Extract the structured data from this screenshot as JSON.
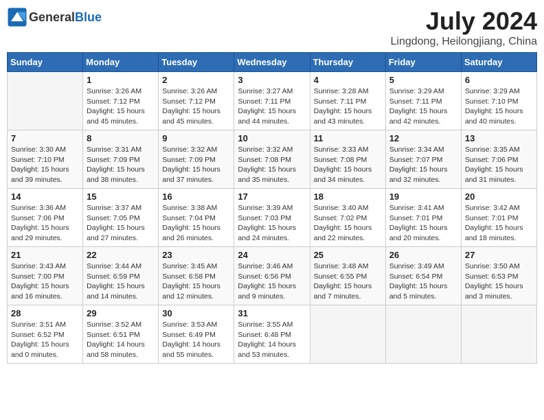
{
  "header": {
    "logo_general": "General",
    "logo_blue": "Blue",
    "month_title": "July 2024",
    "location": "Lingdong, Heilongjiang, China"
  },
  "weekdays": [
    "Sunday",
    "Monday",
    "Tuesday",
    "Wednesday",
    "Thursday",
    "Friday",
    "Saturday"
  ],
  "weeks": [
    [
      {
        "day": "",
        "info": ""
      },
      {
        "day": "1",
        "info": "Sunrise: 3:26 AM\nSunset: 7:12 PM\nDaylight: 15 hours\nand 45 minutes."
      },
      {
        "day": "2",
        "info": "Sunrise: 3:26 AM\nSunset: 7:12 PM\nDaylight: 15 hours\nand 45 minutes."
      },
      {
        "day": "3",
        "info": "Sunrise: 3:27 AM\nSunset: 7:11 PM\nDaylight: 15 hours\nand 44 minutes."
      },
      {
        "day": "4",
        "info": "Sunrise: 3:28 AM\nSunset: 7:11 PM\nDaylight: 15 hours\nand 43 minutes."
      },
      {
        "day": "5",
        "info": "Sunrise: 3:29 AM\nSunset: 7:11 PM\nDaylight: 15 hours\nand 42 minutes."
      },
      {
        "day": "6",
        "info": "Sunrise: 3:29 AM\nSunset: 7:10 PM\nDaylight: 15 hours\nand 40 minutes."
      }
    ],
    [
      {
        "day": "7",
        "info": "Sunrise: 3:30 AM\nSunset: 7:10 PM\nDaylight: 15 hours\nand 39 minutes."
      },
      {
        "day": "8",
        "info": "Sunrise: 3:31 AM\nSunset: 7:09 PM\nDaylight: 15 hours\nand 38 minutes."
      },
      {
        "day": "9",
        "info": "Sunrise: 3:32 AM\nSunset: 7:09 PM\nDaylight: 15 hours\nand 37 minutes."
      },
      {
        "day": "10",
        "info": "Sunrise: 3:32 AM\nSunset: 7:08 PM\nDaylight: 15 hours\nand 35 minutes."
      },
      {
        "day": "11",
        "info": "Sunrise: 3:33 AM\nSunset: 7:08 PM\nDaylight: 15 hours\nand 34 minutes."
      },
      {
        "day": "12",
        "info": "Sunrise: 3:34 AM\nSunset: 7:07 PM\nDaylight: 15 hours\nand 32 minutes."
      },
      {
        "day": "13",
        "info": "Sunrise: 3:35 AM\nSunset: 7:06 PM\nDaylight: 15 hours\nand 31 minutes."
      }
    ],
    [
      {
        "day": "14",
        "info": "Sunrise: 3:36 AM\nSunset: 7:06 PM\nDaylight: 15 hours\nand 29 minutes."
      },
      {
        "day": "15",
        "info": "Sunrise: 3:37 AM\nSunset: 7:05 PM\nDaylight: 15 hours\nand 27 minutes."
      },
      {
        "day": "16",
        "info": "Sunrise: 3:38 AM\nSunset: 7:04 PM\nDaylight: 15 hours\nand 26 minutes."
      },
      {
        "day": "17",
        "info": "Sunrise: 3:39 AM\nSunset: 7:03 PM\nDaylight: 15 hours\nand 24 minutes."
      },
      {
        "day": "18",
        "info": "Sunrise: 3:40 AM\nSunset: 7:02 PM\nDaylight: 15 hours\nand 22 minutes."
      },
      {
        "day": "19",
        "info": "Sunrise: 3:41 AM\nSunset: 7:01 PM\nDaylight: 15 hours\nand 20 minutes."
      },
      {
        "day": "20",
        "info": "Sunrise: 3:42 AM\nSunset: 7:01 PM\nDaylight: 15 hours\nand 18 minutes."
      }
    ],
    [
      {
        "day": "21",
        "info": "Sunrise: 3:43 AM\nSunset: 7:00 PM\nDaylight: 15 hours\nand 16 minutes."
      },
      {
        "day": "22",
        "info": "Sunrise: 3:44 AM\nSunset: 6:59 PM\nDaylight: 15 hours\nand 14 minutes."
      },
      {
        "day": "23",
        "info": "Sunrise: 3:45 AM\nSunset: 6:58 PM\nDaylight: 15 hours\nand 12 minutes."
      },
      {
        "day": "24",
        "info": "Sunrise: 3:46 AM\nSunset: 6:56 PM\nDaylight: 15 hours\nand 9 minutes."
      },
      {
        "day": "25",
        "info": "Sunrise: 3:48 AM\nSunset: 6:55 PM\nDaylight: 15 hours\nand 7 minutes."
      },
      {
        "day": "26",
        "info": "Sunrise: 3:49 AM\nSunset: 6:54 PM\nDaylight: 15 hours\nand 5 minutes."
      },
      {
        "day": "27",
        "info": "Sunrise: 3:50 AM\nSunset: 6:53 PM\nDaylight: 15 hours\nand 3 minutes."
      }
    ],
    [
      {
        "day": "28",
        "info": "Sunrise: 3:51 AM\nSunset: 6:52 PM\nDaylight: 15 hours\nand 0 minutes."
      },
      {
        "day": "29",
        "info": "Sunrise: 3:52 AM\nSunset: 6:51 PM\nDaylight: 14 hours\nand 58 minutes."
      },
      {
        "day": "30",
        "info": "Sunrise: 3:53 AM\nSunset: 6:49 PM\nDaylight: 14 hours\nand 55 minutes."
      },
      {
        "day": "31",
        "info": "Sunrise: 3:55 AM\nSunset: 6:48 PM\nDaylight: 14 hours\nand 53 minutes."
      },
      {
        "day": "",
        "info": ""
      },
      {
        "day": "",
        "info": ""
      },
      {
        "day": "",
        "info": ""
      }
    ]
  ]
}
